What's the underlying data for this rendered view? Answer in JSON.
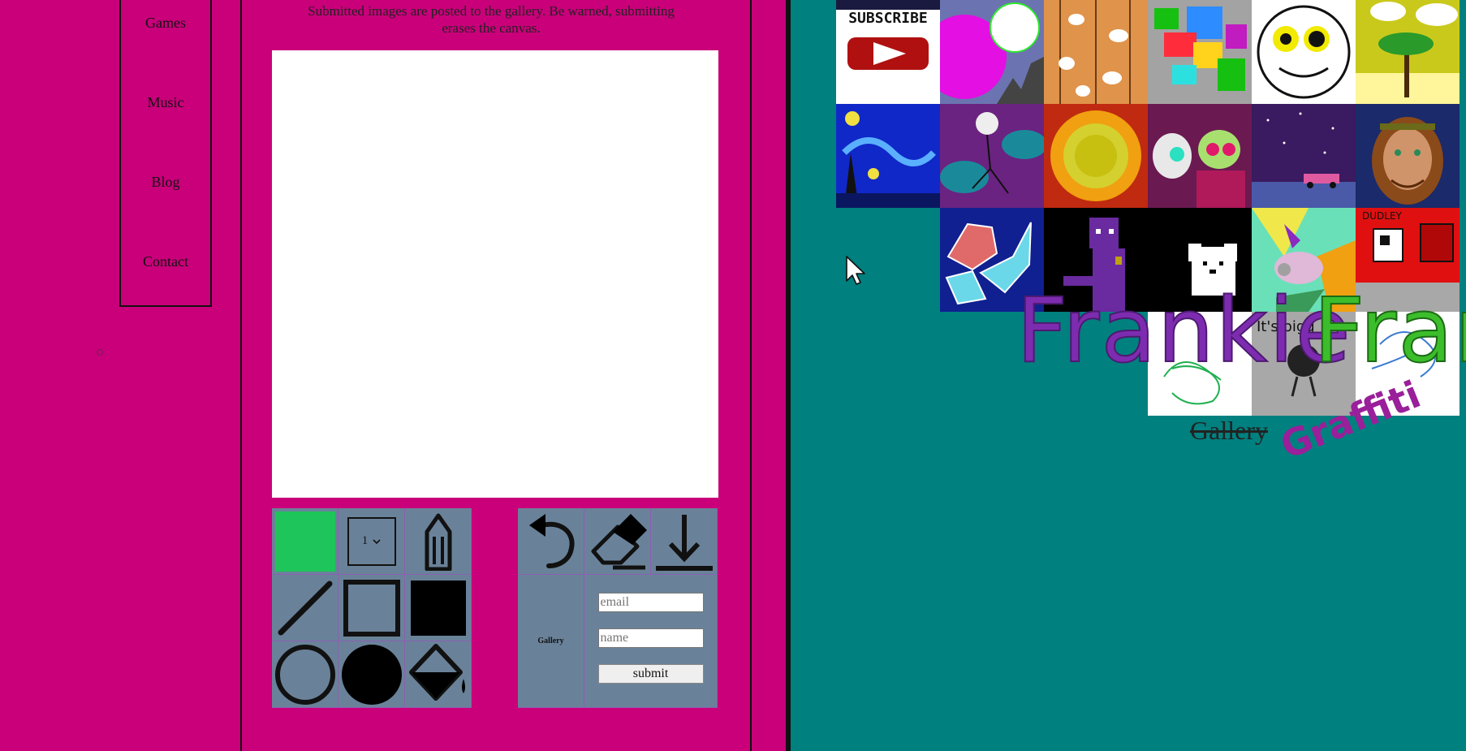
{
  "nav": {
    "items": [
      {
        "label": "Games"
      },
      {
        "label": "Music"
      },
      {
        "label": "Blog"
      },
      {
        "label": "Contact"
      }
    ]
  },
  "intro": {
    "line_top": "Submitted images are posted to the gallery. Be warned, submitting",
    "line_bottom": "erases the canvas."
  },
  "tools": {
    "current_color": "#1ec55a",
    "brush_size": "1",
    "left_icons": [
      "color-swatch",
      "size-select",
      "pencil-icon",
      "line-icon",
      "rectangle-outline-icon",
      "rectangle-filled-icon",
      "circle-outline-icon",
      "circle-filled-icon",
      "fill-bucket-icon"
    ],
    "right_icons": [
      "undo-icon",
      "eraser-icon",
      "download-icon"
    ]
  },
  "gallery_form": {
    "label": "Gallery",
    "email_placeholder": "email",
    "name_placeholder": "name",
    "submit_label": "submit"
  },
  "gallery": {
    "thumb_texts": [
      "SUBSCRIBE",
      "DUDLEY",
      "It's bigg"
    ],
    "logo_part1": "Frankie",
    "logo_part2": "Fran",
    "heading_struck": "Gallery",
    "graffiti": "Graffiti"
  },
  "colors": {
    "page_pink": "#c9007a",
    "panel_teal": "#00807f",
    "toolbar": "#6a8299",
    "logo_purple": "#7d2cb0",
    "logo_green": "#3cbd2b"
  }
}
